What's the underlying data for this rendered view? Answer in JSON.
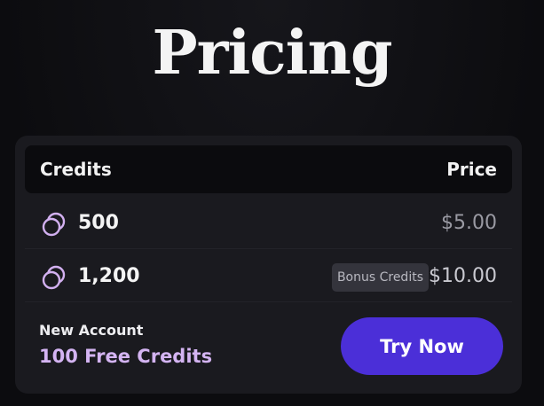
{
  "page": {
    "title": "Pricing"
  },
  "table": {
    "header": {
      "credits_label": "Credits",
      "price_label": "Price"
    },
    "rows": [
      {
        "icon": "coins-icon",
        "amount": "500",
        "price": "$5.00",
        "badge": ""
      },
      {
        "icon": "coins-icon",
        "amount": "1,200",
        "price": "$10.00",
        "badge": "Bonus Credits"
      }
    ]
  },
  "footer": {
    "new_account_label": "New Account",
    "free_credits_text": "100 Free Credits",
    "cta_label": "Try Now"
  },
  "colors": {
    "accent_button": "#4b2fd8",
    "accent_text": "#d4b4f2",
    "card_bg": "#1a1a1f"
  }
}
